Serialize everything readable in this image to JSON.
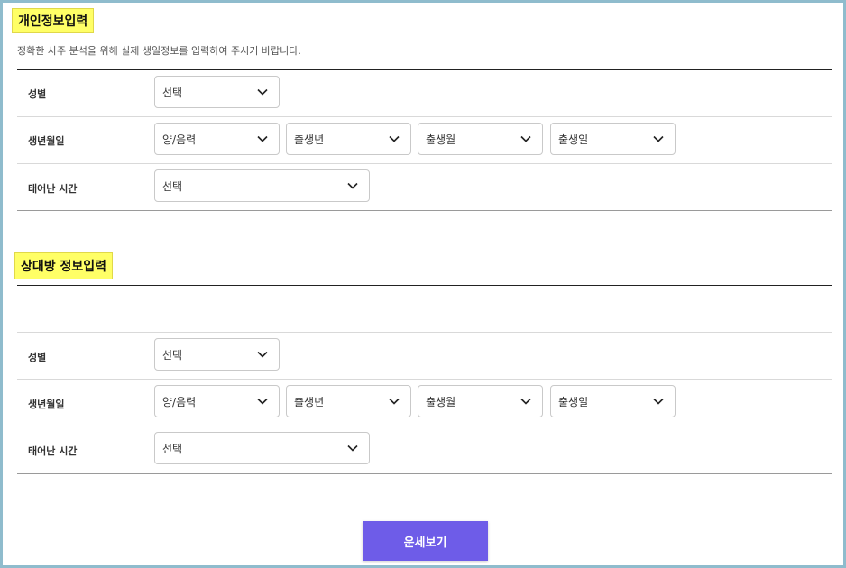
{
  "personal": {
    "title": "개인정보입력",
    "subtitle": "정확한 사주 분석을 위해 실제 생일정보를 입력하여 주시기 바랍니다.",
    "gender": {
      "label": "성별",
      "value": "선택"
    },
    "birthdate": {
      "label": "생년월일",
      "calendar": "양/음력",
      "year": "출생년",
      "month": "출생월",
      "day": "출생일"
    },
    "birthtime": {
      "label": "태어난 시간",
      "value": "선택"
    }
  },
  "partner": {
    "title": "상대방 정보입력",
    "gender": {
      "label": "성별",
      "value": "선택"
    },
    "birthdate": {
      "label": "생년월일",
      "calendar": "양/음력",
      "year": "출생년",
      "month": "출생월",
      "day": "출생일"
    },
    "birthtime": {
      "label": "태어난 시간",
      "value": "선택"
    }
  },
  "submit_label": "운세보기",
  "colors": {
    "accent": "#6e5ce8",
    "highlight": "#ffff66",
    "border": "#8fbccd"
  }
}
